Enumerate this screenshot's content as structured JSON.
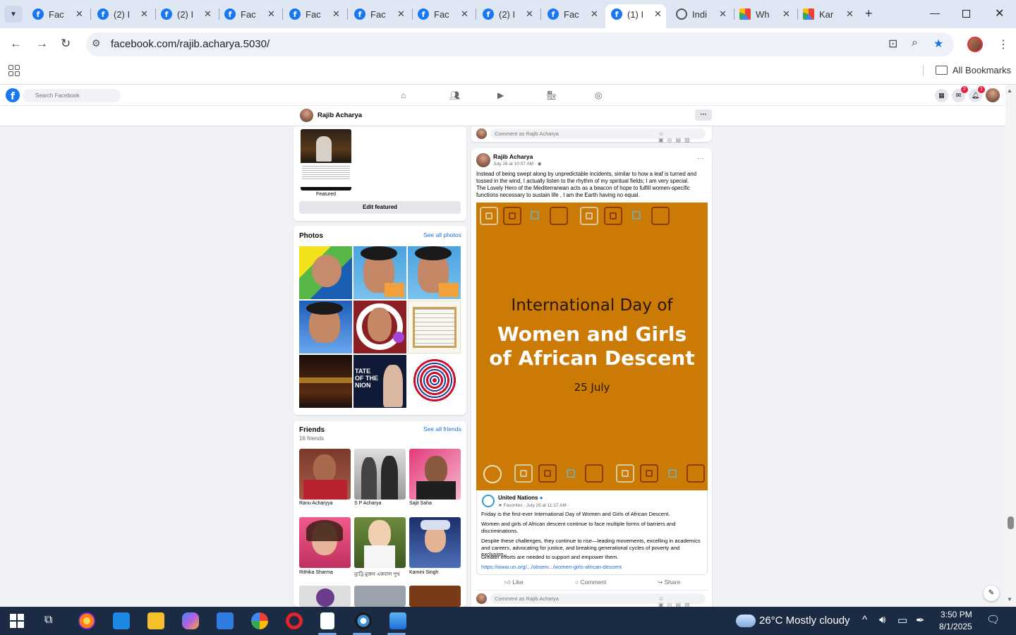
{
  "browser": {
    "tabs": [
      {
        "title": "Fac",
        "icon": "facebook-icon"
      },
      {
        "title": "(2) I",
        "icon": "facebook-icon"
      },
      {
        "title": "(2) I",
        "icon": "facebook-icon"
      },
      {
        "title": "Fac",
        "icon": "facebook-icon"
      },
      {
        "title": "Fac",
        "icon": "facebook-icon"
      },
      {
        "title": "Fac",
        "icon": "facebook-icon"
      },
      {
        "title": "Fac",
        "icon": "facebook-icon"
      },
      {
        "title": "(2) I",
        "icon": "facebook-icon"
      },
      {
        "title": "Fac",
        "icon": "facebook-icon"
      },
      {
        "title": "(1) I",
        "icon": "facebook-icon",
        "active": true
      },
      {
        "title": "Indi",
        "icon": "globe-icon"
      },
      {
        "title": "Wh",
        "icon": "gmail-icon"
      },
      {
        "title": "Kar",
        "icon": "gmail-icon"
      }
    ],
    "url": "facebook.com/rajib.acharya.5030/",
    "bookmarks_label": "All Bookmarks"
  },
  "facebook": {
    "search_placeholder": "Search Facebook",
    "messenger_badge": "2",
    "notifications_badge": "1",
    "profile_name": "Rajib Acharya"
  },
  "left": {
    "featured_label": "Featured",
    "edit_featured": "Edit featured",
    "photos_title": "Photos",
    "see_all_photos": "See all photos",
    "friends_title": "Friends",
    "friends_count": "16 friends",
    "see_all_friends": "See all friends",
    "friends": [
      {
        "name": "Ranu Acharyya"
      },
      {
        "name": "S P Acharya"
      },
      {
        "name": "Sajit Saha"
      },
      {
        "name": "Rithika Sharma"
      },
      {
        "name": "ন্যুট্রি মুক্তন একবাল পুথ"
      },
      {
        "name": "Kamini Singh"
      }
    ]
  },
  "post": {
    "comment_placeholder": "Comment as Rajib Acharya",
    "author": "Rajib Acharya",
    "date": "July 26 at 10:07 AM",
    "text1": "Instead of being swept along by unpredictable incidents, similar to how a leaf is turned and tossed in the wind, I actually listen to the rhythm of my spiritual fields; I am very special.",
    "text2": "The Lovely Hero of the Mediterranean acts as a beacon of hope to fulfill women-specific functions necessary to sustain life , I am the Earth having no equal.",
    "banner_line1": "International Day of",
    "banner_line2": "Women and Girls",
    "banner_line3": "of African Descent",
    "banner_date": "25 July",
    "shared_author": "United Nations",
    "shared_meta": "★ Favorites · July 25 at 11:17 AM ·",
    "shared_p1": "Friday is the first-ever International Day of Women and Girls of African Descent.",
    "shared_p2": "Women and girls of African descent continue to face multiple forms of barriers and discriminations.",
    "shared_p3": "Despite these challenges, they continue to rise—leading movements, excelling in academics and careers, advocating for justice, and breaking generational cycles of poverty and exclusion.",
    "shared_p4": "Greater efforts are needed to support and empower them.",
    "shared_link": "https://www.un.org/.../observ.../women-girls-african-descent",
    "like": "Like",
    "comment": "Comment",
    "share": "Share"
  },
  "taskbar": {
    "weather": "26°C  Mostly cloudy",
    "time": "3:50 PM",
    "date": "8/1/2025"
  },
  "colors": {
    "facebook_blue": "#1877f2",
    "banner_orange": "#cc7a06",
    "link_blue": "#216fdb",
    "taskbar": "#1c2b44"
  }
}
